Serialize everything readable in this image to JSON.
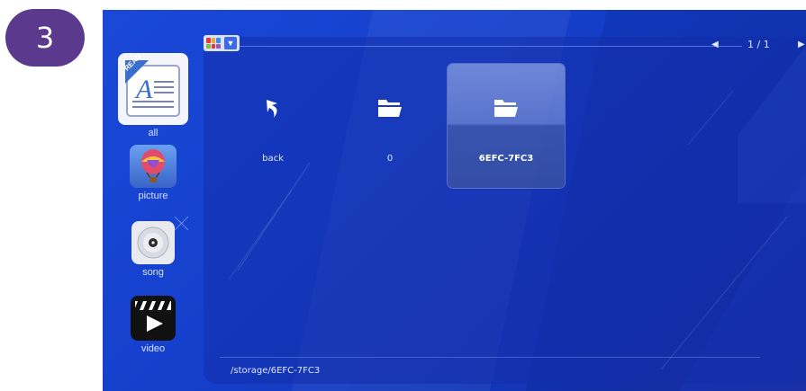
{
  "step_badge": "3",
  "sidebar": {
    "items": [
      {
        "label": "all",
        "icon": "document-read-icon"
      },
      {
        "label": "picture",
        "icon": "hot-air-balloon-icon"
      },
      {
        "label": "song",
        "icon": "music-disc-icon"
      },
      {
        "label": "video",
        "icon": "clapperboard-icon"
      }
    ],
    "all_badge": "READ"
  },
  "toolbar": {
    "view_icon": "grid-view-icon",
    "view_dropdown_icon": "chevron-down-icon",
    "page_indicator": "1 / 1",
    "prev_icon": "◀",
    "next_icon": "▶"
  },
  "files": [
    {
      "label": "back",
      "icon": "back-arrow-icon",
      "selected": false
    },
    {
      "label": "0",
      "icon": "folder-icon",
      "selected": false
    },
    {
      "label": "6EFC-7FC3",
      "icon": "folder-icon",
      "selected": true
    }
  ],
  "status": {
    "path": "/storage/6EFC-7FC3"
  },
  "colors": {
    "background": "#1540cc",
    "badge": "#5b3a8e"
  }
}
